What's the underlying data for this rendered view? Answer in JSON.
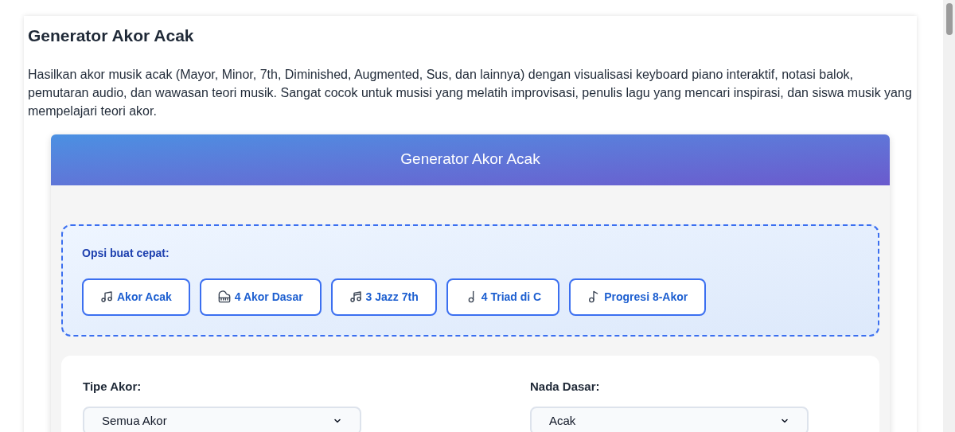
{
  "page": {
    "title": "Generator Akor Acak",
    "description": "Hasilkan akor musik acak (Mayor, Minor, 7th, Diminished, Augmented, Sus, dan lainnya) dengan visualisasi keyboard piano interaktif, notasi balok, pemutaran audio, dan wawasan teori musik. Sangat cocok untuk musisi yang melatih improvisasi, penulis lagu yang mencari inspirasi, dan siswa musik yang mempelajari teori akor."
  },
  "tool": {
    "header": "Generator Akor Acak",
    "quick_options": {
      "label": "Opsi buat cepat:",
      "buttons": [
        {
          "kind": "note",
          "label": "Akor Acak"
        },
        {
          "kind": "piano",
          "label": "4 Akor Dasar"
        },
        {
          "kind": "sax",
          "label": "3 Jazz 7th"
        },
        {
          "kind": "score",
          "label": "4 Triad di C"
        },
        {
          "kind": "notes",
          "label": "Progresi 8-Akor"
        }
      ]
    },
    "fields": [
      {
        "label": "Tipe Akor:",
        "value": "Semua Akor"
      },
      {
        "label": "Nada Dasar:",
        "value": "Acak"
      }
    ]
  }
}
